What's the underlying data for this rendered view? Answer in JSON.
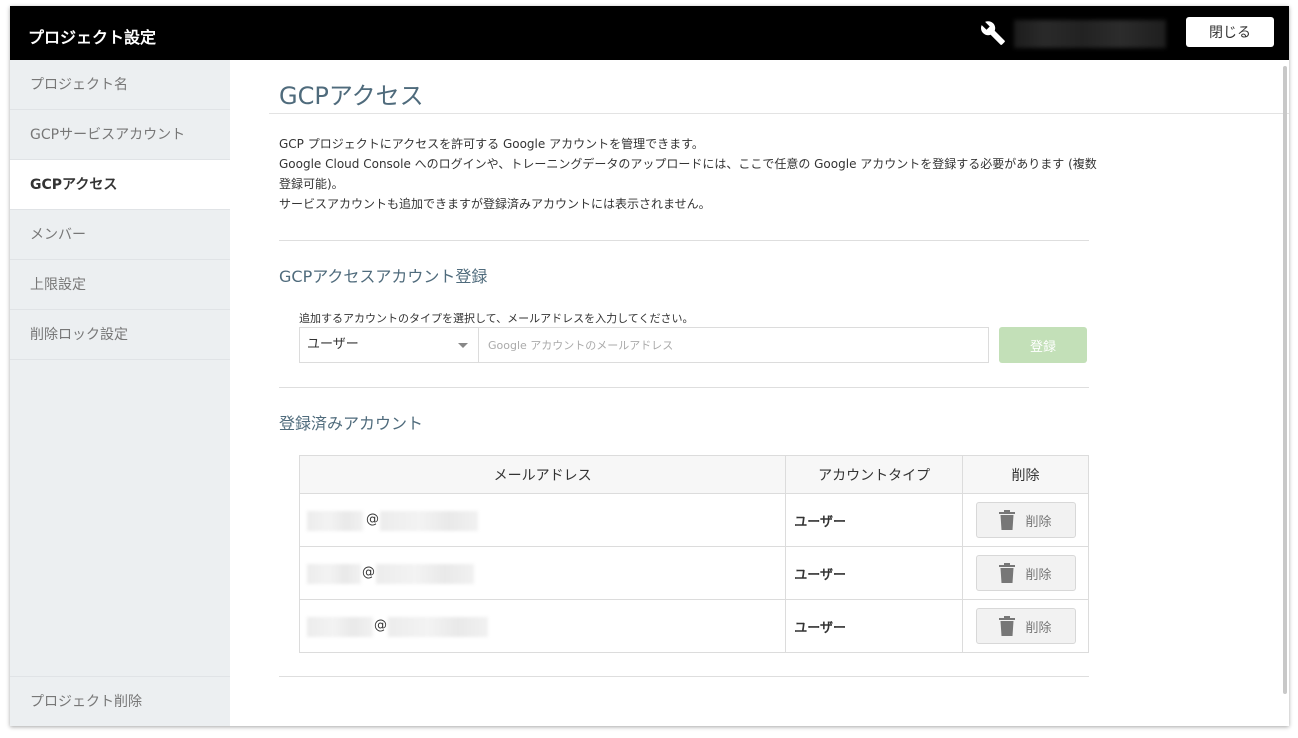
{
  "header": {
    "title": "プロジェクト設定",
    "close_label": "閉じる"
  },
  "sidebar": {
    "items": [
      {
        "label": "プロジェクト名",
        "active": false
      },
      {
        "label": "GCPサービスアカウント",
        "active": false
      },
      {
        "label": "GCPアクセス",
        "active": true
      },
      {
        "label": "メンバー",
        "active": false
      },
      {
        "label": "上限設定",
        "active": false
      },
      {
        "label": "削除ロック設定",
        "active": false
      }
    ],
    "bottom_item": "プロジェクト削除"
  },
  "main": {
    "title": "GCPアクセス",
    "description": [
      "GCP プロジェクトにアクセスを許可する Google アカウントを管理できます。",
      "Google Cloud Console へのログインや、トレーニングデータのアップロードには、ここで任意の Google アカウントを登録する必要があります (複数登録可能)。",
      "サービスアカウントも追加できますが登録済みアカウントには表示されません。"
    ],
    "register_section": {
      "title": "GCPアクセスアカウント登録",
      "instruction": "追加するアカウントのタイプを選択して、メールアドレスを入力してください。",
      "type_value": "ユーザー",
      "email_placeholder": "Google アカウントのメールアドレス",
      "register_label": "登録"
    },
    "registered_section": {
      "title": "登録済みアカウント",
      "columns": [
        "メールアドレス",
        "アカウントタイプ",
        "削除"
      ],
      "rows": [
        {
          "email": "@",
          "type": "ユーザー",
          "delete_label": "削除"
        },
        {
          "email": "@",
          "type": "ユーザー",
          "delete_label": "削除"
        },
        {
          "email": "@",
          "type": "ユーザー",
          "delete_label": "削除"
        }
      ]
    }
  },
  "colors": {
    "header_bg": "#000000",
    "sidebar_bg": "#eceff1",
    "title_color": "#4f6b7c",
    "register_button_bg": "#c3e0b8"
  }
}
